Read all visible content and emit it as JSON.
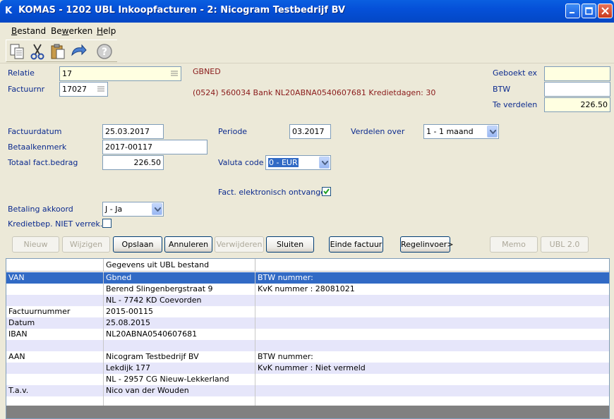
{
  "window": {
    "title": "KOMAS - 1202 UBL Inkoopfacturen - 2: Nicogram Testbedrijf BV",
    "app_icon": "K"
  },
  "menu": [
    {
      "label": "Bestand",
      "key": "B",
      "rest": "estand"
    },
    {
      "label": "Bewerken",
      "key": "w",
      "pre": "Be",
      "rest": "erken"
    },
    {
      "label": "Help",
      "key": "H",
      "rest": "elp"
    }
  ],
  "toolbar": {
    "icons": [
      "copy-icon",
      "cut-icon",
      "paste-icon",
      "undo-icon",
      "help-icon"
    ]
  },
  "header": {
    "relatie_label": "Relatie",
    "relatie_value": "17",
    "factuurnr_label": "Factuurnr",
    "factuurnr_value": "17027",
    "relation_code": "GBNED",
    "relation_info": "(0524) 560034  Bank NL20ABNA0540607681  Kredietdagen: 30",
    "geboekt_label": "Geboekt ex",
    "geboekt_value": "",
    "btw_label": "BTW",
    "btw_value": "",
    "te_verdelen_label": "Te verdelen",
    "te_verdelen_value": "226.50"
  },
  "form": {
    "factuurdatum_label": "Factuurdatum",
    "factuurdatum_value": "25.03.2017",
    "betaalkenmerk_label": "Betaalkenmerk",
    "betaalkenmerk_value": "2017-00117",
    "totaal_label": "Totaal fact.bedrag",
    "totaal_value": "226.50",
    "periode_label": "Periode",
    "periode_value": "03.2017",
    "verdelen_label": "Verdelen over",
    "verdelen_value": "1 - 1 maand",
    "valuta_label": "Valuta code",
    "valuta_value": "0 - EUR",
    "elektronisch_label": "Fact. elektronisch ontvangen",
    "elektronisch_checked": true,
    "betaling_label": "Betaling akkoord",
    "betaling_value": "J - Ja",
    "kredietbep_label": "Kredietbep. NIET verrek.",
    "kredietbep_checked": false
  },
  "buttons": {
    "nieuw": "Nieuw",
    "wijzigen": "Wijzigen",
    "opslaan": "Opslaan",
    "annuleren": "Annuleren",
    "verwijderen": "Verwijderen",
    "sluiten": "Sluiten",
    "einde_factuur": "Einde factuur",
    "regelinvoer": "Regelinvoer>",
    "memo": "Memo",
    "ubl": "UBL 2.0"
  },
  "grid": {
    "header": [
      "",
      "Gegevens uit UBL bestand",
      ""
    ],
    "rows": [
      [
        "VAN",
        "Gbned",
        "BTW nummer:"
      ],
      [
        "",
        "Berend Slingenbergstraat 9",
        "KvK nummer : 28081021"
      ],
      [
        "",
        "NL - 7742 KD  Coevorden",
        ""
      ],
      [
        "Factuurnummer",
        "2015-00115",
        ""
      ],
      [
        "Datum",
        "25.08.2015",
        ""
      ],
      [
        "IBAN",
        "NL20ABNA0540607681",
        ""
      ],
      [
        "",
        "",
        ""
      ],
      [
        "AAN",
        "Nicogram Testbedrijf BV",
        "BTW nummer:"
      ],
      [
        "",
        "Lekdijk 177",
        "KvK nummer : Niet vermeld"
      ],
      [
        "",
        "NL - 2957 CG  Nieuw-Lekkerland",
        ""
      ],
      [
        "T.a.v.",
        "Nico van der Wouden",
        ""
      ],
      [
        "",
        "",
        ""
      ]
    ]
  },
  "colors": {
    "titlebar": "#0550d8",
    "label_blue": "#0b2a8e",
    "info_red": "#8a1a1a",
    "selection": "#316ac5",
    "row_alt": "#e6e6fa",
    "field_yellow": "#ffffe1"
  }
}
